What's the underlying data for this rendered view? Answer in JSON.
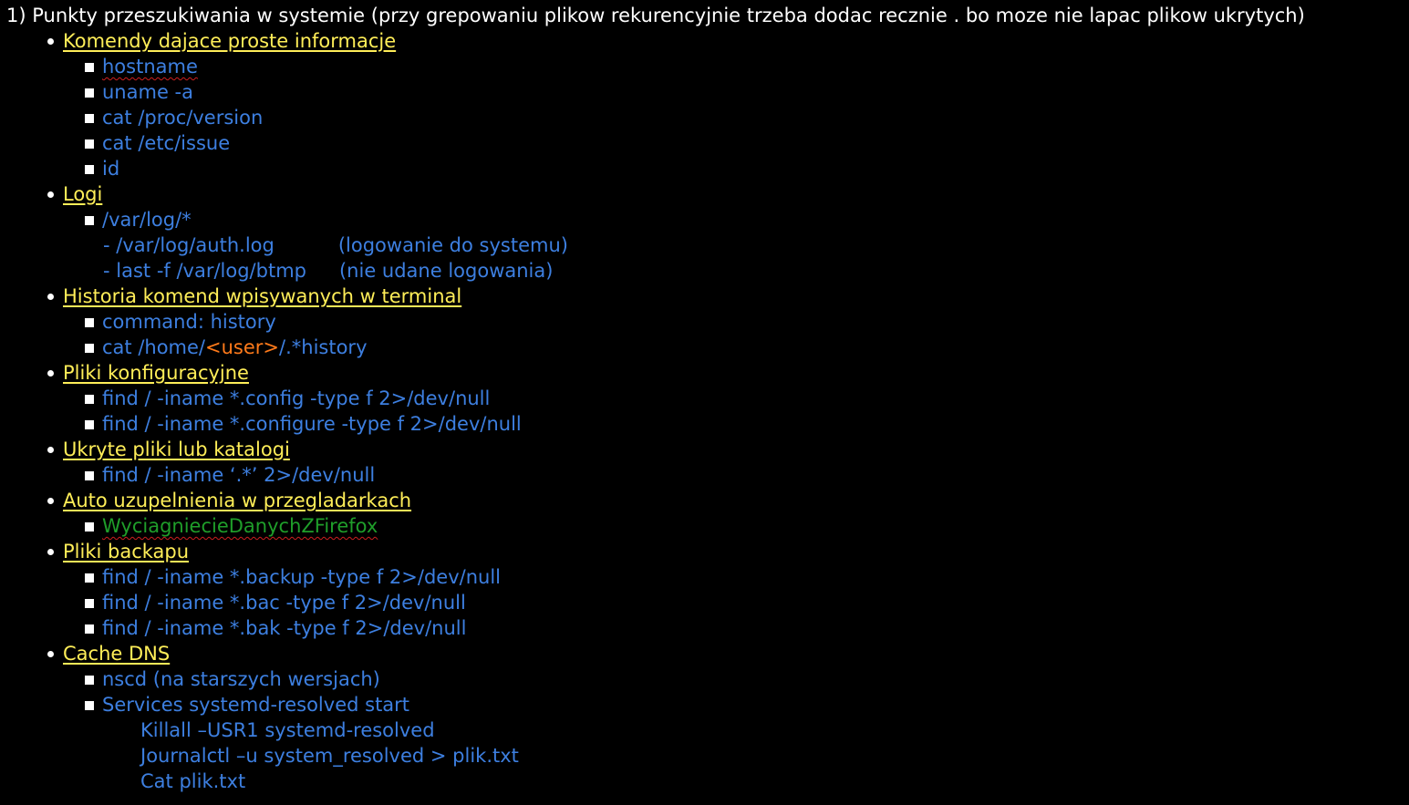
{
  "title": "1) Punkty przeszukiwania w systemie (przy grepowaniu plikow rekurencyjnie trzeba dodac recznie . bo moze nie lapac plikow ukrytych)",
  "sections": [
    {
      "heading": "Komendy dajace proste informacje",
      "items": [
        "hostname",
        "uname -a",
        "cat /proc/version",
        "cat /etc/issue",
        "id"
      ]
    },
    {
      "heading": "Logi",
      "items": [
        "/var/log/*"
      ],
      "subitems": [
        {
          "cmd": "/var/log/auth.log",
          "note": "(logowanie do systemu)"
        },
        {
          "cmd": "last -f /var/log/btmp",
          "note": "(nie udane logowania)"
        }
      ]
    },
    {
      "heading": "Historia komend wpisywanych w terminal",
      "items": [
        "command: history",
        "cat /home/<user>/.*history"
      ],
      "user_token": "<user>"
    },
    {
      "heading": "Pliki konfiguracyjne",
      "items": [
        "find / -iname *.config -type f 2>/dev/null",
        "find / -iname *.configure -type f 2>/dev/null"
      ]
    },
    {
      "heading": "Ukryte pliki lub katalogi",
      "items": [
        "find / -iname ‘.*’ 2>/dev/null"
      ]
    },
    {
      "heading": "Auto uzupelnienia w przegladarkach",
      "items": [
        "WyciagniecieDanychZFirefox"
      ]
    },
    {
      "heading": "Pliki backapu",
      "items": [
        "find / -iname *.backup -type f 2>/dev/null",
        "find / -iname *.bac -type f 2>/dev/null",
        "find / -iname *.bak -type f 2>/dev/null"
      ]
    },
    {
      "heading": "Cache DNS",
      "items": [
        "nscd (na starszych wersjach)",
        "Services systemd-resolved start"
      ],
      "continuation": [
        "Killall –USR1 systemd-resolved",
        "Journalctl –u system_resolved > plik.txt",
        "Cat plik.txt"
      ]
    }
  ],
  "colors": {
    "background": "#000000",
    "title": "#ffffff",
    "heading": "#ffee58",
    "command": "#3d7fe0",
    "placeholder": "#ff7a1a",
    "link": "#1f9e2a",
    "spellcheck": "#cc1f1f"
  }
}
